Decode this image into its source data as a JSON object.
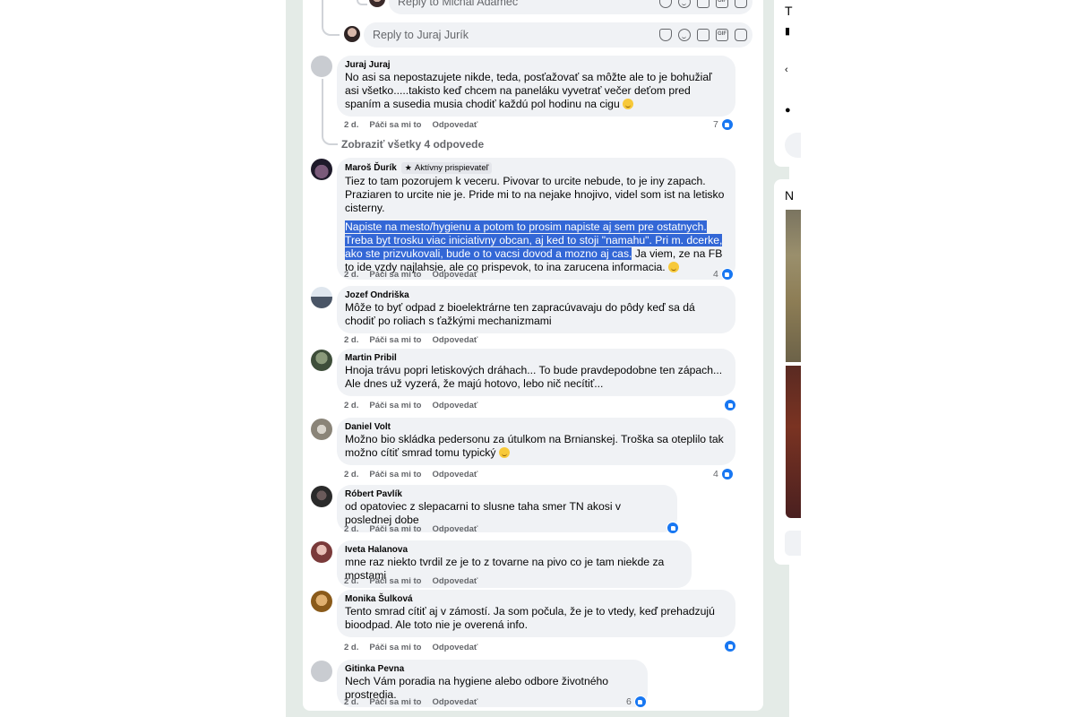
{
  "top_reply": {
    "placeholder": "Reply to Michal Adamec"
  },
  "second_reply": {
    "placeholder": "Reply to Juraj Jurík"
  },
  "view_more": "Zobraziť všetky 4 odpovede",
  "actions": {
    "like": "Páči sa mi to",
    "reply": "Odpovedať"
  },
  "right_panel": {
    "letter_top": "T",
    "letter_mid": "N"
  },
  "comments": [
    {
      "author": "Juraj Juraj",
      "text": "No asi sa nepostazujete nikde, teda, posťažovať sa môžte ale to je bohužiaľ asi všetko.....takisto keď chcem na paneláku vyvetrať večer deťom pred spaním a susedia musia chodiť každú pol hodinu na cigu",
      "time": "2 d.",
      "likes": "7"
    },
    {
      "author": "Maroš Ďurík",
      "badge": "Aktívny prispievateľ",
      "text": "Tiez to tam pozorujem k veceru. Pivovar to urcite nebude, to je iny zapach. Praziaren to urcite nie je. Pride mi to na nejake hnojivo, videl som ist na letisko cisterny.",
      "selected": "Napiste na mesto/hygienu a potom to prosim napiste aj sem pre ostatnych. Treba byt trosku viac iniciativny obcan, aj ked to stoji \"namahu\". Pri m. dcerke, ako ste prizvukovali, bude o to vacsi dovod a mozno aj cas.",
      "text_after": " Ja viem, ze na FB to ide vzdy najlahsie, ale co prispevok, to ina zarucena informacia.",
      "time": "2 d.",
      "likes": "4"
    },
    {
      "author": "Jozef Ondriška",
      "text": "Môže to byť odpad z bioelektrárne ten zapracúvavaju do pôdy keď sa dá chodiť po roliach s ťažkými mechanizmami",
      "time": "2 d.",
      "likes": ""
    },
    {
      "author": "Martin Pribil",
      "text": "Hnoja trávu popri letiskových dráhach... To bude pravdepodobne ten zápach... Ale dnes už vyzerá, že majú hotovo, lebo nič necítiť...",
      "time": "2 d.",
      "likes": ""
    },
    {
      "author": "Daniel Volt",
      "text": "Možno bio skládka pedersonu za útulkom na Brnianskej. Troška sa oteplilo tak možno cítiť smrad tomu typický",
      "time": "2 d.",
      "likes": "4"
    },
    {
      "author": "Róbert Pavlík",
      "text": "od opatoviec z slepacarni to slusne taha smer TN akosi v poslednej dobe",
      "time": "2 d.",
      "likes": ""
    },
    {
      "author": "Iveta Halanova",
      "text": "mne raz niekto tvrdil ze je to z tovarne na pivo co je tam niekde za mostami",
      "time": "2 d.",
      "likes": ""
    },
    {
      "author": "Monika Šulková",
      "text": "Tento smrad cítiť aj v zámostí. Ja som počula, že je to vtedy, keď prehadzujú bioodpad. Ale toto nie je overená info.",
      "time": "2 d.",
      "likes": ""
    },
    {
      "author": "Gitinka Pevna",
      "text": "Nech Vám poradia na hygiene alebo odbore životného prostredia.",
      "time": "2 d.",
      "likes": "6"
    }
  ],
  "colors": {
    "accent": "#1877f2",
    "bubble": "#f0f2f5",
    "selection": "#3367d6",
    "backdrop": "#e4ebe7"
  }
}
